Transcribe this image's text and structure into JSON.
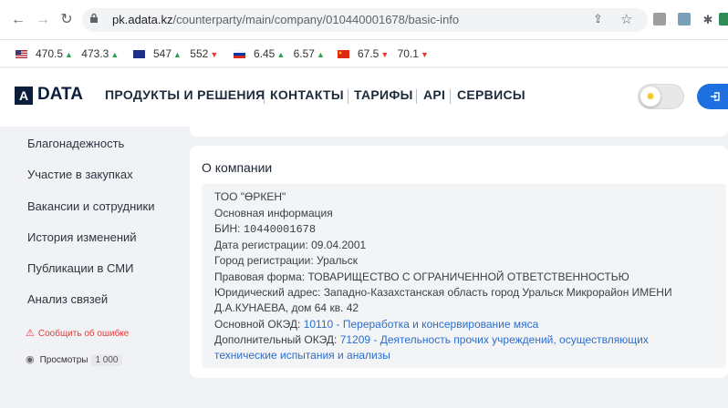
{
  "browser": {
    "url_host": "pk.adata.kz",
    "url_path": "/counterparty/main/company/010440001678/basic-info",
    "back_icon": "arrow-left-icon",
    "forward_icon": "arrow-right-icon",
    "reload_icon": "reload-icon"
  },
  "ticker": {
    "usd": {
      "buy": "470.5",
      "sell": "473.3",
      "buy_trend": "up",
      "sell_trend": "up"
    },
    "eur": {
      "buy": "547",
      "sell": "552",
      "buy_trend": "up",
      "sell_trend": "down"
    },
    "rub": {
      "buy": "6.45",
      "sell": "6.57",
      "buy_trend": "up",
      "sell_trend": "up"
    },
    "cny": {
      "buy": "67.5",
      "sell": "70.1",
      "buy_trend": "down",
      "sell_trend": "down"
    },
    "up_glyph": "▲",
    "down_glyph": "▼"
  },
  "header": {
    "logo_mark": "A",
    "logo_text": "DATA",
    "nav": [
      "ПРОДУКТЫ И РЕШЕНИЯ",
      "КОНТАКТЫ",
      "ТАРИФЫ",
      "API",
      "СЕРВИСЫ"
    ]
  },
  "sidebar": {
    "items": [
      "Благонадежность",
      "Участие в закупках",
      "Вакансии и сотрудники",
      "История изменений",
      "Публикации в СМИ",
      "Анализ связей"
    ],
    "report_label": "Сообщить об ошибке",
    "views_label": "Просмотры",
    "views_count": "1 000"
  },
  "company": {
    "section_title": "О компании",
    "name": "ТОО \"ӨРКЕН\"",
    "basic_info": "Основная информация",
    "bin_label": "БИН: ",
    "bin_value": "10440001678",
    "reg_date": "Дата регистрации: 09.04.2001",
    "reg_city": "Город регистрации: Уральск",
    "legal_form": "Правовая форма: ТОВАРИЩЕСТВО С ОГРАНИЧЕННОЙ ОТВЕТСТВЕННОСТЬЮ",
    "address_line1": "Юридический адрес: Западно-Казахстанская область город Уральск Микрорайон ИМЕНИ",
    "address_line2": "Д.А.КУНАЕВА, дом 64 кв. 42",
    "main_oked_label": "Основной ОКЭД: ",
    "main_oked_value": "10110 - Переработка и консервирование мяса",
    "extra_oked_label": "Дополнительный ОКЭД: ",
    "extra_oked_value_line1": "71209 - Деятельность прочих учреждений, осуществляющих",
    "extra_oked_value_line2": "технические испытания и анализы"
  },
  "colors": {
    "accent": "#1e6fe0",
    "link": "#2c6ecb",
    "up": "#2aa44f",
    "down": "#e53935",
    "logo": "#0b1f3a"
  }
}
